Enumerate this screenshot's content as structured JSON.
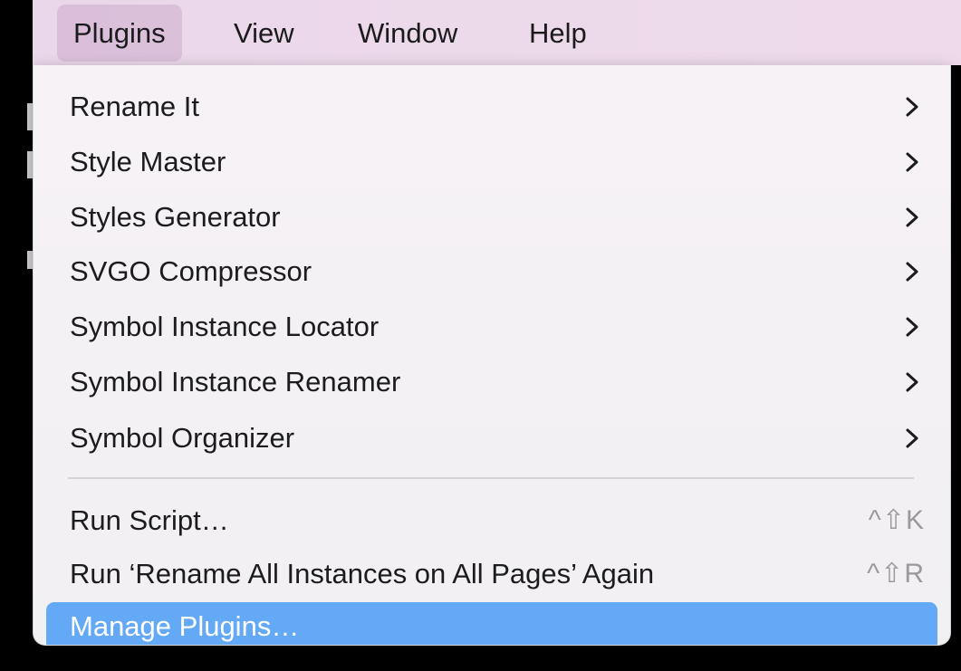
{
  "menubar": {
    "items": [
      {
        "label": "Plugins",
        "active": true
      },
      {
        "label": "View",
        "active": false
      },
      {
        "label": "Window",
        "active": false
      },
      {
        "label": "Help",
        "active": false
      }
    ]
  },
  "dropdown": {
    "submenu_items": [
      {
        "label": "Rename It",
        "icon": "chevron-right-icon"
      },
      {
        "label": "Style Master",
        "icon": "chevron-right-icon"
      },
      {
        "label": "Styles Generator",
        "icon": "chevron-right-icon"
      },
      {
        "label": "SVGO Compressor",
        "icon": "chevron-right-icon"
      },
      {
        "label": "Symbol Instance Locator",
        "icon": "chevron-right-icon"
      },
      {
        "label": "Symbol Instance Renamer",
        "icon": "chevron-right-icon"
      },
      {
        "label": "Symbol Organizer",
        "icon": "chevron-right-icon"
      }
    ],
    "action_items": [
      {
        "label": "Run Script…",
        "shortcut": "^⇧K"
      },
      {
        "label": "Run ‘Rename All Instances on All Pages’ Again",
        "shortcut": "^⇧R"
      },
      {
        "label": "Manage Plugins…",
        "shortcut": "",
        "highlighted": true
      }
    ]
  },
  "colors": {
    "highlight": "#63a9f5",
    "menubar_bg": "#ecd9ea",
    "menu_bg": "#f4f1f4",
    "shortcut_text": "#9a9a9e"
  }
}
